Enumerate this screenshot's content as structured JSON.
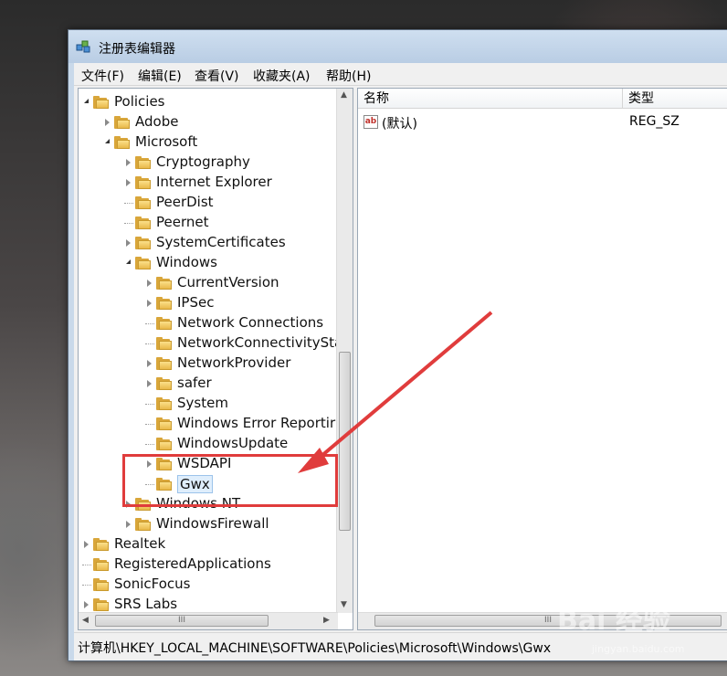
{
  "window": {
    "title": "注册表编辑器"
  },
  "menu": [
    {
      "label": "文件(F)"
    },
    {
      "label": "编辑(E)"
    },
    {
      "label": "查看(V)"
    },
    {
      "label": "收藏夹(A)"
    },
    {
      "label": "帮助(H)"
    }
  ],
  "tree": {
    "items": [
      {
        "label": "Policies",
        "level": 0,
        "state": "expanded"
      },
      {
        "label": "Adobe",
        "level": 1,
        "state": "collapsed"
      },
      {
        "label": "Microsoft",
        "level": 1,
        "state": "expanded"
      },
      {
        "label": "Cryptography",
        "level": 2,
        "state": "collapsed"
      },
      {
        "label": "Internet Explorer",
        "level": 2,
        "state": "collapsed"
      },
      {
        "label": "PeerDist",
        "level": 2,
        "state": "none"
      },
      {
        "label": "Peernet",
        "level": 2,
        "state": "none"
      },
      {
        "label": "SystemCertificates",
        "level": 2,
        "state": "collapsed"
      },
      {
        "label": "Windows",
        "level": 2,
        "state": "expanded"
      },
      {
        "label": "CurrentVersion",
        "level": 3,
        "state": "collapsed"
      },
      {
        "label": "IPSec",
        "level": 3,
        "state": "collapsed"
      },
      {
        "label": "Network Connections",
        "level": 3,
        "state": "none"
      },
      {
        "label": "NetworkConnectivitySta",
        "level": 3,
        "state": "none"
      },
      {
        "label": "NetworkProvider",
        "level": 3,
        "state": "collapsed"
      },
      {
        "label": "safer",
        "level": 3,
        "state": "collapsed"
      },
      {
        "label": "System",
        "level": 3,
        "state": "none"
      },
      {
        "label": "Windows Error Reportir",
        "level": 3,
        "state": "none"
      },
      {
        "label": "WindowsUpdate",
        "level": 3,
        "state": "none"
      },
      {
        "label": "WSDAPI",
        "level": 3,
        "state": "collapsed"
      },
      {
        "label": "Gwx",
        "level": 3,
        "state": "none",
        "selected": true
      },
      {
        "label": "Windows NT",
        "level": 2,
        "state": "collapsed"
      },
      {
        "label": "WindowsFirewall",
        "level": 2,
        "state": "collapsed"
      },
      {
        "label": "Realtek",
        "level": 0,
        "state": "collapsed"
      },
      {
        "label": "RegisteredApplications",
        "level": 0,
        "state": "none"
      },
      {
        "label": "SonicFocus",
        "level": 0,
        "state": "none"
      },
      {
        "label": "SRS Labs",
        "level": 0,
        "state": "collapsed"
      }
    ],
    "hscroll_label": "III"
  },
  "list": {
    "columns": [
      {
        "label": "名称"
      },
      {
        "label": "类型"
      }
    ],
    "rows": [
      {
        "name": "(默认)",
        "type": "REG_SZ",
        "icon": "ab-string-icon"
      }
    ],
    "hscroll_label": "III"
  },
  "statusbar": {
    "path": "计算机\\HKEY_LOCAL_MACHINE\\SOFTWARE\\Policies\\Microsoft\\Windows\\Gwx"
  },
  "watermark": {
    "text": "Bai 经验",
    "sub": "jingyan.baidu.com"
  },
  "colors": {
    "highlight": "#e03c3c",
    "folder": "#e9b94a"
  }
}
